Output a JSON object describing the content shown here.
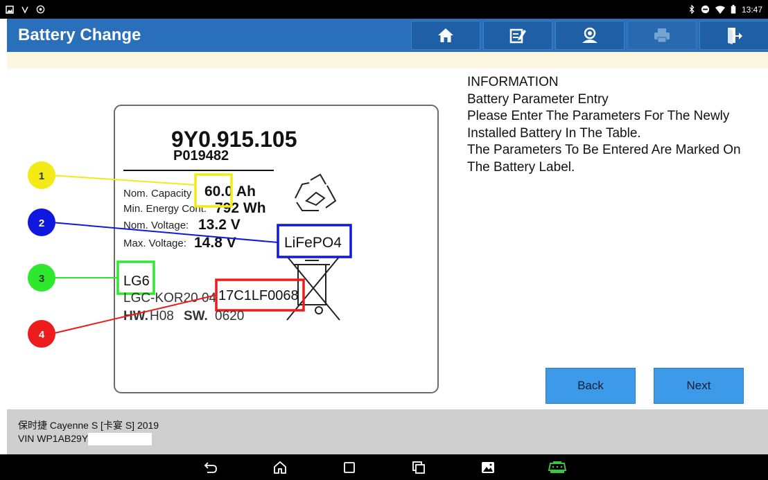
{
  "status_bar": {
    "time": "13:47",
    "left_icons": [
      "gallery-icon",
      "usb-icon",
      "settings-icon"
    ],
    "right_icons": [
      "bluetooth-icon",
      "dnd-icon",
      "wifi-icon",
      "battery-icon"
    ]
  },
  "header": {
    "title": "Battery Change",
    "toolbar": [
      {
        "name": "home-icon",
        "enabled": true
      },
      {
        "name": "edit-report-icon",
        "enabled": true
      },
      {
        "name": "support-icon",
        "enabled": true
      },
      {
        "name": "print-icon",
        "enabled": false
      },
      {
        "name": "exit-icon",
        "enabled": true
      }
    ],
    "colors": {
      "bar": "#2a6fb9",
      "button": "#1f5fa6"
    }
  },
  "label_image": {
    "part_number": "9Y0.915.105",
    "sub_number": "P019482",
    "specs": [
      {
        "label": "Nom. Capacity",
        "value": "60.0 Ah"
      },
      {
        "label": "Min. Energy Cont.",
        "value": "792 Wh"
      },
      {
        "label": "Nom. Voltage:",
        "value": "13.2 V"
      },
      {
        "label": "Max. Voltage:",
        "value": "14.8 V"
      }
    ],
    "chemistry": "LiFePO4",
    "maker": "LG6",
    "serial_prefix": "LGC-KOR20 04",
    "serial": "17C1LF0068",
    "hw_label": "HW.",
    "hw_value": "H08",
    "sw_label": "SW.",
    "sw_value": "0620",
    "markers": [
      {
        "number": "1",
        "color": "#f3ea16"
      },
      {
        "number": "2",
        "color": "#1018e0"
      },
      {
        "number": "3",
        "color": "#2ee82e"
      },
      {
        "number": "4",
        "color": "#ec1c1c"
      }
    ]
  },
  "info": {
    "lines": [
      "INFORMATION",
      "Battery Parameter Entry",
      "Please Enter The Parameters For The Newly",
      "Installed Battery In The Table.",
      "The Parameters To Be Entered Are Marked On",
      "The Battery Label."
    ]
  },
  "buttons": {
    "back": "Back",
    "next": "Next"
  },
  "footer": {
    "vehicle": "保时捷 Cayenne S [卡宴 S] 2019",
    "vin": "VIN WP1AB29Y"
  },
  "nav_bar": {
    "icons": [
      "back-icon",
      "home-icon",
      "recent-apps-icon",
      "multi-window-icon",
      "screenshot-icon",
      "vci-icon"
    ]
  }
}
